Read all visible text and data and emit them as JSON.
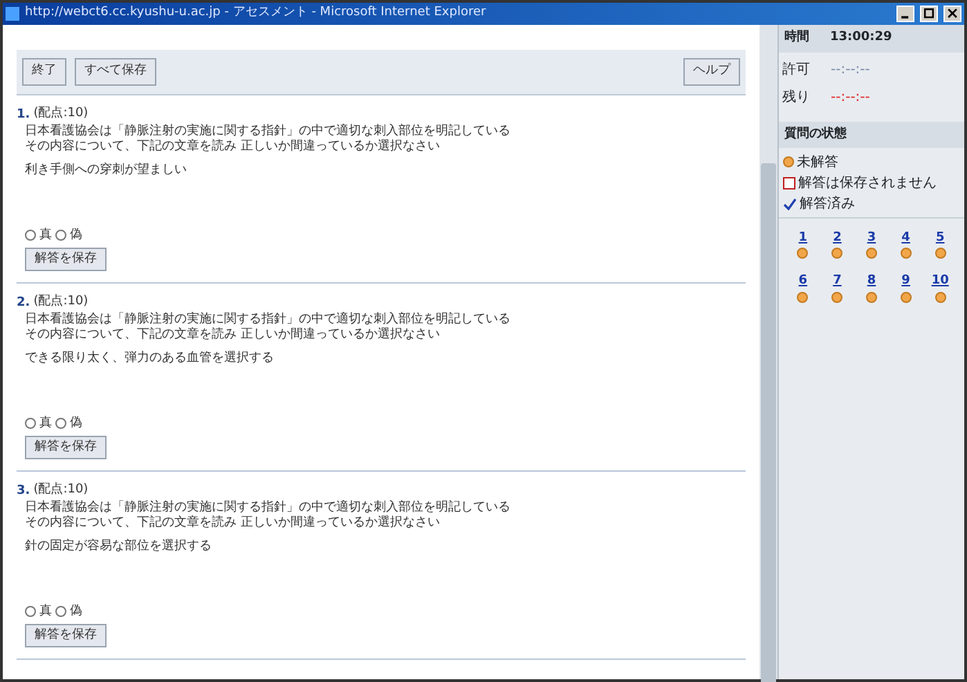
{
  "window": {
    "title": "http://webct6.cc.kyushu-u.ac.jp - アセスメント - Microsoft Internet Explorer"
  },
  "toolbar": {
    "left_buttons": [
      "終了",
      "すべて保存"
    ],
    "right_button": "ヘルプ"
  },
  "questions": [
    {
      "number": "1.",
      "points": "(配点:10)",
      "prompt": "日本看護協会は「静脈注射の実施に関する指針」の中で適切な刺入部位を明記している",
      "instruction": "その内容について、下記の文章を読み 正しいか間違っているか選択なさい",
      "statement": "利き手側への穿刺が望ましい",
      "options": [
        {
          "label": "真",
          "selected": false
        },
        {
          "label": "偽",
          "selected": false
        }
      ],
      "save_button": "解答を保存"
    },
    {
      "number": "2.",
      "points": "(配点:10)",
      "prompt": "日本看護協会は「静脈注射の実施に関する指針」の中で適切な刺入部位を明記している",
      "instruction": "その内容について、下記の文章を読み 正しいか間違っているか選択なさい",
      "statement": "できる限り太く、弾力のある血管を選択する",
      "options": [
        {
          "label": "真",
          "selected": false
        },
        {
          "label": "偽",
          "selected": false
        }
      ],
      "save_button": "解答を保存"
    },
    {
      "number": "3.",
      "points": "(配点:10)",
      "prompt": "日本看護協会は「静脈注射の実施に関する指針」の中で適切な刺入部位を明記している",
      "instruction": "その内容について、下記の文章を読み 正しいか間違っているか選択なさい",
      "statement": "針の固定が容易な部位を選択する",
      "options": [
        {
          "label": "真",
          "selected": false
        },
        {
          "label": "偽",
          "selected": false
        }
      ],
      "save_button": "解答を保存"
    }
  ],
  "sidebar": {
    "time_label": "時間",
    "time_value": "13:00:29",
    "timers": [
      {
        "label": "許可",
        "value": "--:--:--",
        "warning": false
      },
      {
        "label": "残り",
        "value": "--:--:--",
        "warning": true
      }
    ],
    "status_heading": "質問の状態",
    "legend": [
      {
        "kind": "unanswered",
        "label": "未解答"
      },
      {
        "kind": "unsaved",
        "label": "解答は保存されません"
      },
      {
        "kind": "answered",
        "label": "解答済み"
      }
    ],
    "question_links": [
      {
        "label": "1",
        "kind": "unanswered"
      },
      {
        "label": "2",
        "kind": "unanswered"
      },
      {
        "label": "3",
        "kind": "unanswered"
      },
      {
        "label": "4",
        "kind": "unanswered"
      },
      {
        "label": "5",
        "kind": "unanswered"
      },
      {
        "label": "6",
        "kind": "unanswered"
      },
      {
        "label": "7",
        "kind": "unanswered"
      },
      {
        "label": "8",
        "kind": "unanswered"
      },
      {
        "label": "9",
        "kind": "unanswered"
      },
      {
        "label": "10",
        "kind": "unanswered"
      }
    ]
  }
}
